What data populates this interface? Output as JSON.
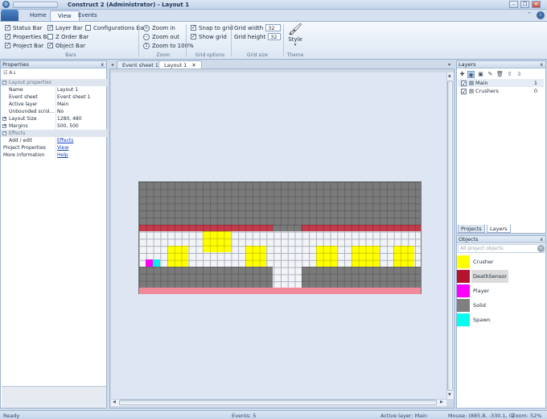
{
  "window": {
    "title": "Construct 2 (Administrator) - Layout 1",
    "app_icon": "construct-gear-icon"
  },
  "ribbon": {
    "tabs": [
      "Home",
      "View",
      "Events"
    ],
    "active_tab": "View",
    "bars": {
      "status_bar": "Status Bar",
      "properties_bar": "Properties Bar",
      "project_bar": "Project Bar",
      "layer_bar": "Layer Bar",
      "z_order_bar": "Z Order Bar",
      "object_bar": "Object Bar",
      "configurations_bar": "Configurations Bar",
      "label": "Bars"
    },
    "zoom": {
      "zoom_in": "Zoom in",
      "zoom_out": "Zoom out",
      "zoom_100": "Zoom to 100%",
      "label": "Zoom"
    },
    "grid_options": {
      "snap": "Snap to grid",
      "show": "Show grid",
      "label": "Grid options"
    },
    "grid_size": {
      "width_label": "Grid width",
      "width": "32",
      "height_label": "Grid height",
      "height": "32",
      "label": "Grid size"
    },
    "theme": {
      "style": "Style",
      "label": "Theme"
    }
  },
  "properties": {
    "title": "Properties",
    "section_layout": "Layout properties",
    "rows": [
      {
        "k": "Name",
        "v": "Layout 1"
      },
      {
        "k": "Event sheet",
        "v": "Event sheet 1"
      },
      {
        "k": "Active layer",
        "v": "Main"
      },
      {
        "k": "Unbounded scrol...",
        "v": "No"
      },
      {
        "k": "Layout Size",
        "v": "1280, 480"
      },
      {
        "k": "Margins",
        "v": "500, 500"
      }
    ],
    "section_effects": "Effects",
    "add_edit": "Add / edit",
    "effects_link": "Effects",
    "project_properties": "Project Properties",
    "view_link": "View",
    "more_information": "More information",
    "help_link": "Help"
  },
  "doc_tabs": [
    "Event sheet 1",
    "Layout 1"
  ],
  "active_doc_tab": "Layout 1",
  "layers": {
    "title": "Layers",
    "items": [
      {
        "name": "Main",
        "index": "1"
      },
      {
        "name": "Crushers",
        "index": "0"
      }
    ],
    "tabs": [
      "Projects",
      "Layers"
    ]
  },
  "objects": {
    "title": "Objects",
    "filter": "All project objects",
    "items": [
      {
        "name": "Crusher",
        "color": "#ffff00"
      },
      {
        "name": "DeathSensor",
        "color": "#b5142a"
      },
      {
        "name": "Player",
        "color": "#ff00ff"
      },
      {
        "name": "Solid",
        "color": "#808080"
      },
      {
        "name": "Spawn",
        "color": "#00ffee"
      }
    ]
  },
  "status": {
    "ready": "Ready",
    "events": "Events: 5",
    "active_layer": "Active layer: Main",
    "mouse": "Mouse: (885.8, -330.1, 0)",
    "zoom": "Zoom: 52%"
  },
  "colors": {
    "solid": "#7a7a7a",
    "crusher": "#ffff00",
    "death": "#c33a4a",
    "player": "#ff00ff",
    "spawn": "#00eeee"
  }
}
